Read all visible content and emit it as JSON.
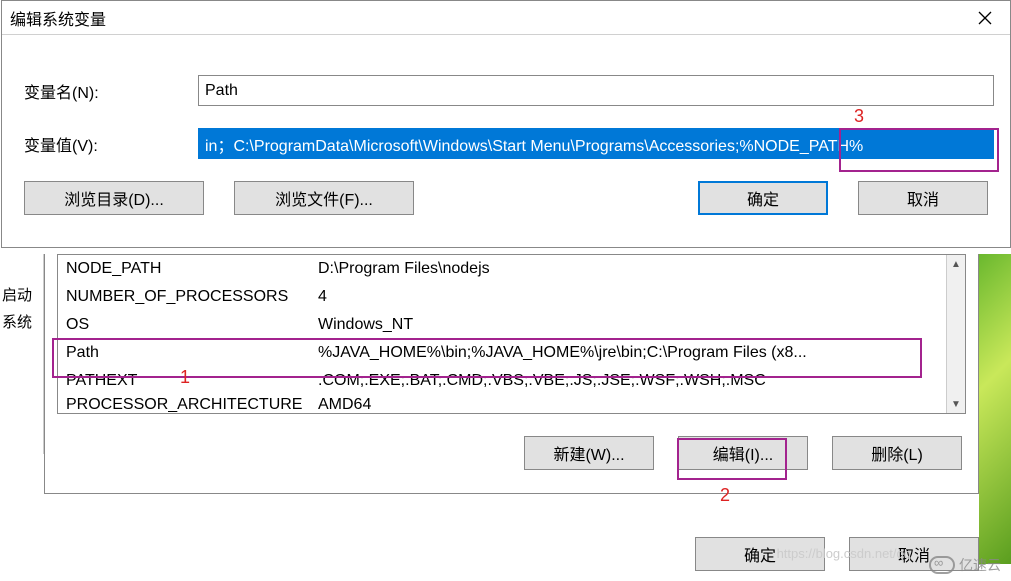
{
  "dialog": {
    "title": "编辑系统变量",
    "name_label": "变量名(N):",
    "name_value": "Path",
    "value_label": "变量值(V):",
    "value_value": "in；C:\\ProgramData\\Microsoft\\Windows\\Start Menu\\Programs\\Accessories;%NODE_PATH%",
    "browse_dir": "浏览目录(D)...",
    "browse_file": "浏览文件(F)...",
    "ok": "确定",
    "cancel": "取消"
  },
  "back_left": {
    "text1": "启动",
    "text2": "系统"
  },
  "env_list": [
    {
      "name": "NODE_PATH",
      "value": "D:\\Program Files\\nodejs"
    },
    {
      "name": "NUMBER_OF_PROCESSORS",
      "value": "4"
    },
    {
      "name": "OS",
      "value": "Windows_NT"
    },
    {
      "name": "Path",
      "value": "%JAVA_HOME%\\bin;%JAVA_HOME%\\jre\\bin;C:\\Program Files (x8..."
    },
    {
      "name": "PATHEXT",
      "value": ".COM;.EXE;.BAT;.CMD;.VBS;.VBE;.JS;.JSE;.WSF;.WSH;.MSC"
    },
    {
      "name": "PROCESSOR_ARCHITECTURE",
      "value": "AMD64"
    }
  ],
  "list_buttons": {
    "new": "新建(W)...",
    "edit": "编辑(I)...",
    "delete": "删除(L)"
  },
  "bottom": {
    "ok": "确定",
    "cancel": "取消"
  },
  "annotations": {
    "a1": "1",
    "a2": "2",
    "a3": "3"
  },
  "watermark": {
    "text": "亿速云",
    "faded": "https://blog.csdn.net/qq"
  }
}
